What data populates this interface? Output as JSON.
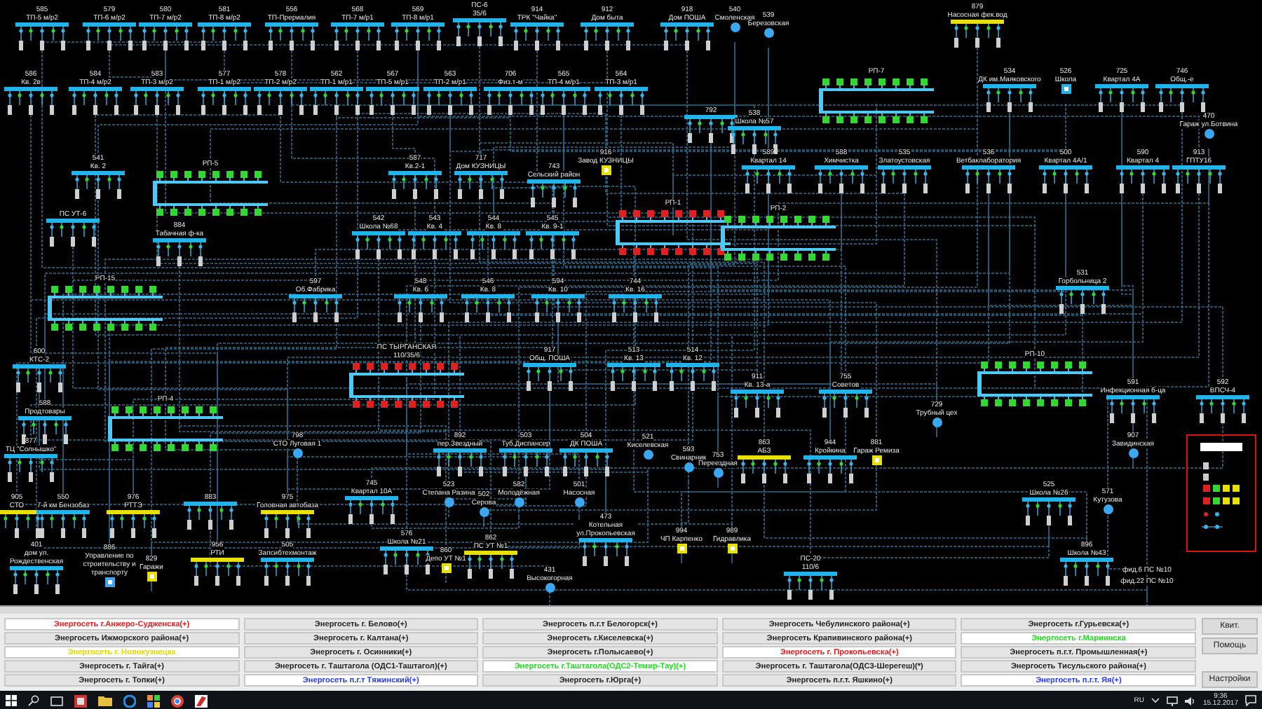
{
  "diagram": {
    "nodes": [
      {
        "number": "585",
        "name": "ТП-5 м/р2",
        "kind": "bus",
        "color": "#1fb5ec"
      },
      {
        "number": "579",
        "name": "ТП-6 м/р2",
        "kind": "bus",
        "color": "#1fb5ec"
      },
      {
        "number": "580",
        "name": "ТП-7 м/р2",
        "kind": "bus",
        "color": "#1fb5ec"
      },
      {
        "number": "581",
        "name": "ТП-8 м/р2",
        "kind": "bus",
        "color": "#1fb5ec"
      },
      {
        "number": "556",
        "name": "ТП-Прериалия",
        "kind": "bus",
        "color": "#1fb5ec"
      },
      {
        "number": "568",
        "name": "ТП-7 м/р1",
        "kind": "bus",
        "color": "#1fb5ec"
      },
      {
        "number": "569",
        "name": "ТП-8 м/р1",
        "kind": "bus",
        "color": "#1fb5ec"
      },
      {
        "number": "ПС-6",
        "name": "35/6",
        "kind": "bus",
        "color": "#1fb5ec"
      },
      {
        "number": "914",
        "name": "ТРК \"Чайка\"",
        "kind": "bus",
        "color": "#1fb5ec"
      },
      {
        "number": "912",
        "name": "Дом быта",
        "kind": "bus",
        "color": "#1fb5ec"
      },
      {
        "number": "918",
        "name": "Дом ПОША",
        "kind": "bus",
        "color": "#1fb5ec"
      },
      {
        "number": "540",
        "name": "Смоленская",
        "kind": "point",
        "color": "#3aa8f0"
      },
      {
        "number": "539",
        "name": "Березовская",
        "kind": "point",
        "color": "#3aa8f0"
      },
      {
        "number": "879",
        "name": "Насосная фек.вод",
        "kind": "bus",
        "color": "#e8e000"
      },
      {
        "number": "586",
        "name": "Кв. 2в",
        "kind": "bus",
        "color": "#1fb5ec"
      },
      {
        "number": "584",
        "name": "ТП-4 м/р2",
        "kind": "bus",
        "color": "#1fb5ec"
      },
      {
        "number": "583",
        "name": "ТП-3 м/р2",
        "kind": "bus",
        "color": "#1fb5ec"
      },
      {
        "number": "577",
        "name": "ТП-1 м/р2",
        "kind": "bus",
        "color": "#1fb5ec"
      },
      {
        "number": "578",
        "name": "ТП-2 м/р2",
        "kind": "bus",
        "color": "#1fb5ec"
      },
      {
        "number": "562",
        "name": "ТП-1 м/р1",
        "kind": "bus",
        "color": "#1fb5ec"
      },
      {
        "number": "567",
        "name": "ТП-5 м/р1",
        "kind": "bus",
        "color": "#1fb5ec"
      },
      {
        "number": "563",
        "name": "ТП-2 м/р1",
        "kind": "bus",
        "color": "#1fb5ec"
      },
      {
        "number": "706",
        "name": "Физ.т-м",
        "kind": "bus",
        "color": "#1fb5ec"
      },
      {
        "number": "565",
        "name": "ТП-4 м/р1",
        "kind": "bus",
        "color": "#1fb5ec"
      },
      {
        "number": "564",
        "name": "ТП-3 м/р1",
        "kind": "bus",
        "color": "#1fb5ec"
      },
      {
        "name": "РП-7",
        "kind": "switchgear",
        "color": "#30d830"
      },
      {
        "number": "534",
        "name": "ДК им.Маяковского",
        "kind": "bus",
        "color": "#1fb5ec"
      },
      {
        "number": "526",
        "name": "Школа",
        "kind": "square",
        "color": "#1fb5ec"
      },
      {
        "number": "725",
        "name": "Квартал 4А",
        "kind": "bus",
        "color": "#1fb5ec"
      },
      {
        "number": "746",
        "name": "Общ.-е",
        "kind": "bus",
        "color": "#1fb5ec"
      },
      {
        "number": "792",
        "kind": "bus",
        "color": "#1fb5ec"
      },
      {
        "number": "538",
        "name": "Школа №57",
        "kind": "bus",
        "color": "#1fb5ec"
      },
      {
        "number": "470",
        "name": "Гараж ул.Ботвина",
        "kind": "point",
        "color": "#3aa8f0"
      },
      {
        "number": "541",
        "name": "Кв. 2",
        "kind": "bus",
        "color": "#1fb5ec"
      },
      {
        "name": "РП-5",
        "kind": "switchgear",
        "color": "#30d830"
      },
      {
        "number": "587",
        "name": "Кв.2-1",
        "kind": "bus",
        "color": "#1fb5ec"
      },
      {
        "number": "717",
        "name": "Дом КУЗНИЦЫ",
        "kind": "bus",
        "color": "#1fb5ec"
      },
      {
        "number": "743",
        "name": "Сельский район",
        "kind": "bus",
        "color": "#1fb5ec"
      },
      {
        "number": "916",
        "name": "Завод КУЗНИЦЫ",
        "kind": "square",
        "color": "#e8e000"
      },
      {
        "number": "589",
        "name": "Квартал 14",
        "kind": "bus",
        "color": "#1fb5ec"
      },
      {
        "number": "588",
        "name": "Химчистка",
        "kind": "bus",
        "color": "#1fb5ec"
      },
      {
        "number": "535",
        "name": "Златоустовская",
        "kind": "bus",
        "color": "#1fb5ec"
      },
      {
        "number": "536",
        "name": "Ветбаклаборатория",
        "kind": "bus",
        "color": "#1fb5ec"
      },
      {
        "number": "500",
        "name": "Квартал 4А/1",
        "kind": "bus",
        "color": "#1fb5ec"
      },
      {
        "number": "590",
        "name": "Квартал 4",
        "kind": "bus",
        "color": "#1fb5ec"
      },
      {
        "number": "913",
        "name": "ГПТУ16",
        "kind": "bus",
        "color": "#1fb5ec"
      },
      {
        "name": "ПС УТ-6",
        "kind": "bus",
        "color": "#1fb5ec"
      },
      {
        "number": "884",
        "name": "Табачная ф-ка",
        "kind": "bus",
        "color": "#1fb5ec"
      },
      {
        "number": "542",
        "name": "Школа №68",
        "kind": "bus",
        "color": "#1fb5ec"
      },
      {
        "number": "543",
        "name": "Кв. 4",
        "kind": "bus",
        "color": "#1fb5ec"
      },
      {
        "number": "544",
        "name": "Кв. 8",
        "kind": "bus",
        "color": "#1fb5ec"
      },
      {
        "number": "545",
        "name": "Кв. 9-1",
        "kind": "bus",
        "color": "#1fb5ec"
      },
      {
        "name": "РП-1",
        "kind": "switchgear",
        "color": "#e02020"
      },
      {
        "name": "РП-2",
        "kind": "switchgear",
        "color": "#30d830"
      },
      {
        "name": "РП-15",
        "kind": "switchgear",
        "color": "#30d830"
      },
      {
        "number": "597",
        "name": "Об.Фабрика",
        "kind": "bus",
        "color": "#1fb5ec"
      },
      {
        "number": "548",
        "name": "Кв. 6",
        "kind": "bus",
        "color": "#1fb5ec"
      },
      {
        "number": "546",
        "name": "Кв. 8",
        "kind": "bus",
        "color": "#1fb5ec"
      },
      {
        "number": "594",
        "name": "Кв. 10",
        "kind": "bus",
        "color": "#1fb5ec"
      },
      {
        "number": "744",
        "name": "Кв. 16",
        "kind": "bus",
        "color": "#1fb5ec"
      },
      {
        "number": "531",
        "name": "Горбольница 2",
        "kind": "bus",
        "color": "#1fb5ec"
      },
      {
        "number": "600",
        "name": "КТС-2",
        "kind": "bus",
        "color": "#1fb5ec"
      },
      {
        "number": "ПС ТЫРГАНСКАЯ",
        "name": "110/35/6",
        "kind": "switchgear",
        "color": "#e02020"
      },
      {
        "number": "917",
        "name": "Общ. ПОША",
        "kind": "bus",
        "color": "#1fb5ec"
      },
      {
        "number": "513",
        "name": "Кв. 13",
        "kind": "bus",
        "color": "#1fb5ec"
      },
      {
        "number": "514",
        "name": "Кв. 12",
        "kind": "bus",
        "color": "#1fb5ec"
      },
      {
        "name": "РП-10",
        "kind": "switchgear",
        "color": "#30d830"
      },
      {
        "number": "911",
        "name": "Кв. 13-а",
        "kind": "bus",
        "color": "#1fb5ec"
      },
      {
        "number": "755",
        "name": "Советов",
        "kind": "bus",
        "color": "#1fb5ec"
      },
      {
        "number": "591",
        "name": "Инфекционная б-ца",
        "kind": "bus",
        "color": "#1fb5ec"
      },
      {
        "number": "592",
        "name": "ВПСЧ-4",
        "kind": "bus",
        "color": "#1fb5ec"
      },
      {
        "number": "588",
        "name": "Продтовары",
        "kind": "bus",
        "color": "#1fb5ec"
      },
      {
        "name": "РП-4",
        "kind": "switchgear",
        "color": "#30d830"
      },
      {
        "number": "729",
        "name": "Трубный цех",
        "kind": "point",
        "color": "#3aa8f0"
      },
      {
        "number": "877",
        "name": "ТЦ \"Солнышко\"",
        "kind": "bus",
        "color": "#1fb5ec"
      },
      {
        "number": "798",
        "name": "СТО Луговая 1",
        "kind": "point",
        "color": "#3aa8f0"
      },
      {
        "number": "892",
        "name": "пер.Звездный",
        "kind": "bus",
        "color": "#1fb5ec"
      },
      {
        "number": "503",
        "name": "Туб.Диспансер",
        "kind": "bus",
        "color": "#1fb5ec"
      },
      {
        "number": "504",
        "name": "ДК ПОША",
        "kind": "bus",
        "color": "#1fb5ec"
      },
      {
        "number": "521",
        "name": "Киселевская",
        "kind": "point",
        "color": "#3aa8f0"
      },
      {
        "number": "593",
        "name": "Свинарник",
        "kind": "point",
        "color": "#3aa8f0"
      },
      {
        "number": "753",
        "name": "Переездная",
        "kind": "point",
        "color": "#3aa8f0"
      },
      {
        "number": "863",
        "name": "АБЗ",
        "kind": "bus",
        "color": "#e8e000"
      },
      {
        "number": "944",
        "name": "Кройкина",
        "kind": "bus",
        "color": "#1fb5ec"
      },
      {
        "number": "881",
        "name": "Гараж Ремиза",
        "kind": "square",
        "color": "#e8e000"
      },
      {
        "number": "907",
        "name": "Завидинская",
        "kind": "point",
        "color": "#3aa8f0"
      },
      {
        "number": "905",
        "name": "СТО",
        "kind": "bus",
        "color": "#e8e000"
      },
      {
        "number": "550",
        "name": "7-й км Бензобаз",
        "kind": "bus",
        "color": "#1fb5ec"
      },
      {
        "number": "976",
        "name": "РТТЭ",
        "kind": "bus",
        "color": "#e8e000"
      },
      {
        "number": "883",
        "kind": "bus",
        "color": "#1fb5ec"
      },
      {
        "number": "975",
        "name": "Головная автобаза",
        "kind": "bus",
        "color": "#e8e000"
      },
      {
        "number": "745",
        "name": "Квартал 10А",
        "kind": "bus",
        "color": "#1fb5ec"
      },
      {
        "number": "523",
        "name": "Степана Разина",
        "kind": "point",
        "color": "#3aa8f0"
      },
      {
        "number": "502",
        "name": "Серова",
        "kind": "point",
        "color": "#3aa8f0"
      },
      {
        "number": "582",
        "name": "Молодёжная",
        "kind": "point",
        "color": "#3aa8f0"
      },
      {
        "number": "501",
        "name": "Насосная",
        "kind": "point",
        "color": "#3aa8f0"
      },
      {
        "number": "525",
        "name": "Школа №26",
        "kind": "bus",
        "color": "#1fb5ec"
      },
      {
        "number": "571",
        "name": "Кутузова",
        "kind": "point",
        "color": "#3aa8f0"
      },
      {
        "number": "401",
        "name": "дом ул. Рождественская",
        "kind": "bus",
        "color": "#1fb5ec"
      },
      {
        "number": "886",
        "name": "Управление по строительству и транспорту",
        "kind": "square",
        "color": "#3aa8f0"
      },
      {
        "number": "829",
        "name": "Гаражи",
        "kind": "square",
        "color": "#e8e000"
      },
      {
        "number": "956",
        "name": "РТИ",
        "kind": "bus",
        "color": "#e8e000"
      },
      {
        "number": "505",
        "name": "Запсибтехмонтаж",
        "kind": "bus",
        "color": "#1fb5ec"
      },
      {
        "number": "576",
        "name": "Школа №21",
        "kind": "bus",
        "color": "#1fb5ec"
      },
      {
        "number": "860",
        "name": "Депо УТ №1",
        "kind": "square",
        "color": "#e8e000"
      },
      {
        "number": "862",
        "name": "ПС УТ №1",
        "kind": "bus",
        "color": "#e8e000"
      },
      {
        "number": "473",
        "name": "Котельная ул.Прокопьевская",
        "kind": "bus",
        "color": "#1fb5ec"
      },
      {
        "number": "994",
        "name": "ЧП Карпенко",
        "kind": "square",
        "color": "#e8e000"
      },
      {
        "number": "989",
        "name": "Гидравлика",
        "kind": "square",
        "color": "#e8e000"
      },
      {
        "number": "896",
        "name": "Школа №43",
        "kind": "bus",
        "color": "#1fb5ec"
      },
      {
        "number": "431",
        "name": "Высокогорная",
        "kind": "point",
        "color": "#3aa8f0"
      },
      {
        "number": "ПС-20",
        "name": "110/6",
        "kind": "bus",
        "color": "#1fb5ec"
      },
      {
        "name": "фид.6 ПС №10",
        "kind": "text"
      },
      {
        "name": "фид.22 ПС №10",
        "kind": "text"
      }
    ]
  },
  "grid_buttons": [
    {
      "label": "Энергосеть г.Анжеро-Судженска(+)",
      "color": "#f01818",
      "highlighted": true
    },
    {
      "label": "Энергосеть г. Белово(+)",
      "color": "#222222",
      "highlighted": false
    },
    {
      "label": "Энергосеть п.г.т Белогорск(+)",
      "color": "#222222",
      "highlighted": false
    },
    {
      "label": "Энергосеть Чебулинского района(+)",
      "color": "#222222",
      "highlighted": false
    },
    {
      "label": "Энергосеть г.Гурьевска(+)",
      "color": "#222222",
      "highlighted": false
    },
    {
      "label": "Энергосеть Ижморского района(+)",
      "color": "#222222",
      "highlighted": false
    },
    {
      "label": "Энергосеть г. Калтана(+)",
      "color": "#222222",
      "highlighted": false
    },
    {
      "label": "Энергосеть г.Киселевска(+)",
      "color": "#222222",
      "highlighted": false
    },
    {
      "label": "Энергосеть Крапивинского района(+)",
      "color": "#222222",
      "highlighted": false
    },
    {
      "label": "Энергосеть г.Мариинска",
      "color": "#20e020",
      "highlighted": true
    },
    {
      "label": "Энергосеть г. Новокузнецка",
      "color": "#e8d800",
      "highlighted": true
    },
    {
      "label": "Энергосеть г. Осинники(+)",
      "color": "#222222",
      "highlighted": false
    },
    {
      "label": "Энергосеть г.Полысаево(+)",
      "color": "#222222",
      "highlighted": false
    },
    {
      "label": "Энергосеть г. Прокопьевска(+)",
      "color": "#f01818",
      "highlighted": true
    },
    {
      "label": "Энергосеть п.г.т. Промышленная(+)",
      "color": "#222222",
      "highlighted": false
    },
    {
      "label": "Энергосеть г. Тайга(+)",
      "color": "#222222",
      "highlighted": false
    },
    {
      "label": "Энергосеть г. Таштагола (ОДС1-Таштагол)(+)",
      "color": "#222222",
      "highlighted": false
    },
    {
      "label": "Энергосеть г.Таштагола(ОДС2-Темир-Тау)(+)",
      "color": "#20e020",
      "highlighted": true
    },
    {
      "label": "Энергосеть г. Таштагола(ОДС3-Шерегеш)(*)",
      "color": "#222222",
      "highlighted": false
    },
    {
      "label": "Энергосеть Тисульского района(+)",
      "color": "#222222",
      "highlighted": false
    },
    {
      "label": "Энергосеть г. Топки(+)",
      "color": "#222222",
      "highlighted": false
    },
    {
      "label": "Энергосеть п.г.т Тяжинский(+)",
      "color": "#2838ff",
      "highlighted": true
    },
    {
      "label": "Энергосеть г.Юрга(+)",
      "color": "#222222",
      "highlighted": false
    },
    {
      "label": "Энергосеть п.г.т. Яшкино(+)",
      "color": "#222222",
      "highlighted": false
    },
    {
      "label": "Энергосеть п.г.т. Яя(+)",
      "color": "#2838ff",
      "highlighted": true
    }
  ],
  "side_buttons": [
    "Квит.",
    "Помощь",
    "Настройки"
  ],
  "taskbar": {
    "language": "RU",
    "time": "9:36",
    "date": "15.12.2017"
  }
}
